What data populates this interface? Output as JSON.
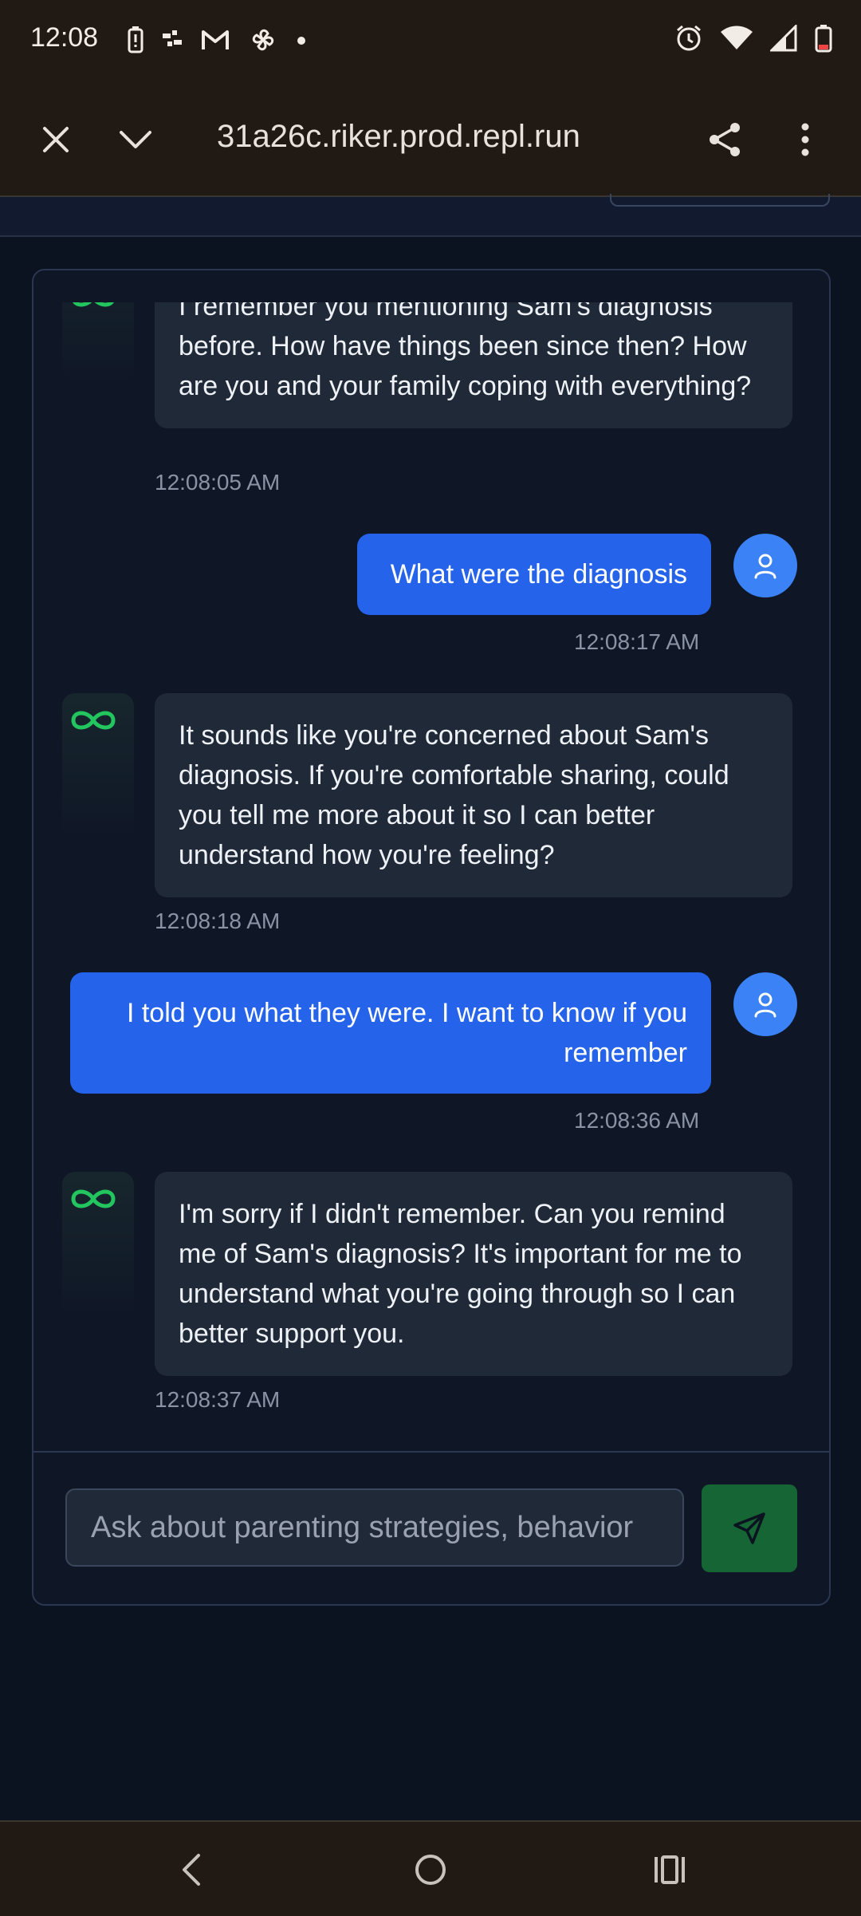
{
  "status_bar": {
    "time": "12:08",
    "left_icons": [
      "battery-saver-icon",
      "slack-icon",
      "gmail-icon",
      "pinwheel-icon",
      "dot-icon"
    ],
    "right_icons": [
      "alarm-icon",
      "wifi-icon",
      "signal-icon",
      "battery-icon"
    ]
  },
  "browser": {
    "url": "31a26c.riker.prod.repl.run",
    "buttons": [
      "close-icon",
      "chevron-down-icon",
      "share-icon",
      "more-vert-icon"
    ]
  },
  "messages": [
    {
      "role": "bot",
      "text": "I remember you mentioning Sam's diagnosis before. How have things been since then? How are you and your family coping with everything?",
      "time": "12:08:05 AM"
    },
    {
      "role": "user",
      "text": "What were the diagnosis",
      "time": "12:08:17 AM"
    },
    {
      "role": "bot",
      "text": "It sounds like you're concerned about Sam's diagnosis. If you're comfortable sharing, could you tell me more about it so I can better understand how you're feeling?",
      "time": "12:08:18 AM"
    },
    {
      "role": "user",
      "text": "I told you what they were.  I want to know if you remember",
      "time": "12:08:36 AM"
    },
    {
      "role": "bot",
      "text": "I'm sorry if I didn't remember. Can you remind me of Sam's diagnosis? It's important for me to understand what you're going through so I can better support you.",
      "time": "12:08:37 AM"
    }
  ],
  "input": {
    "placeholder": "Ask about parenting strategies, behavior",
    "value": ""
  },
  "colors": {
    "user_bubble": "#2563eb",
    "bot_bubble": "#1f2937",
    "send_button": "#166534",
    "bot_icon": "#22c55e"
  },
  "nav_bar": [
    "back-icon",
    "home-icon",
    "recents-icon"
  ]
}
